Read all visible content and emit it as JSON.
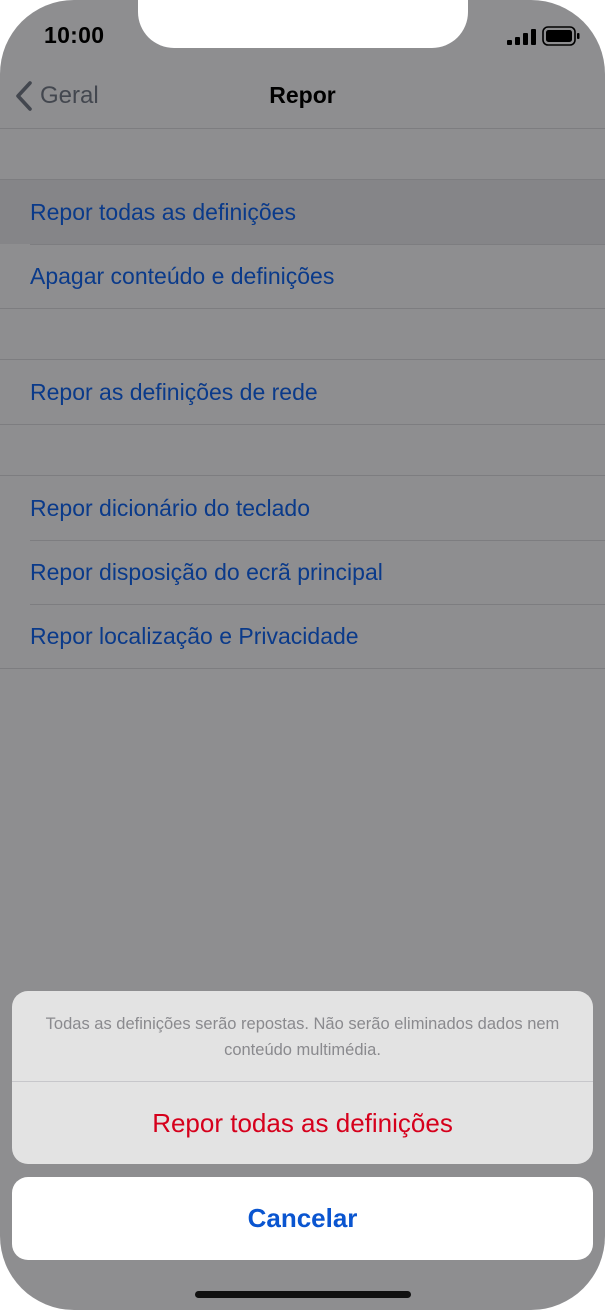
{
  "status_bar": {
    "time": "10:00",
    "signal_icon": "cellular-signal-icon",
    "battery_icon": "battery-icon"
  },
  "nav": {
    "back_label": "Geral",
    "back_icon": "chevron-left-icon",
    "title": "Repor"
  },
  "list": {
    "group1": [
      {
        "label": "Repor todas as definições",
        "highlighted": true
      },
      {
        "label": "Apagar conteúdo e definições"
      }
    ],
    "group2": [
      {
        "label": "Repor as definições de rede"
      }
    ],
    "group3": [
      {
        "label": "Repor dicionário do teclado"
      },
      {
        "label": "Repor disposição do ecrã principal"
      },
      {
        "label": "Repor localização e Privacidade"
      }
    ]
  },
  "action_sheet": {
    "message": "Todas as definições serão repostas. Não serão eliminados dados nem conteúdo multimédia.",
    "confirm_label": "Repor todas as definições",
    "cancel_label": "Cancelar"
  },
  "colors": {
    "link_text": "#0a3a8a",
    "destructive": "#d6001c",
    "cancel": "#0a55d0",
    "dim_overlay": "#8e8e90"
  }
}
